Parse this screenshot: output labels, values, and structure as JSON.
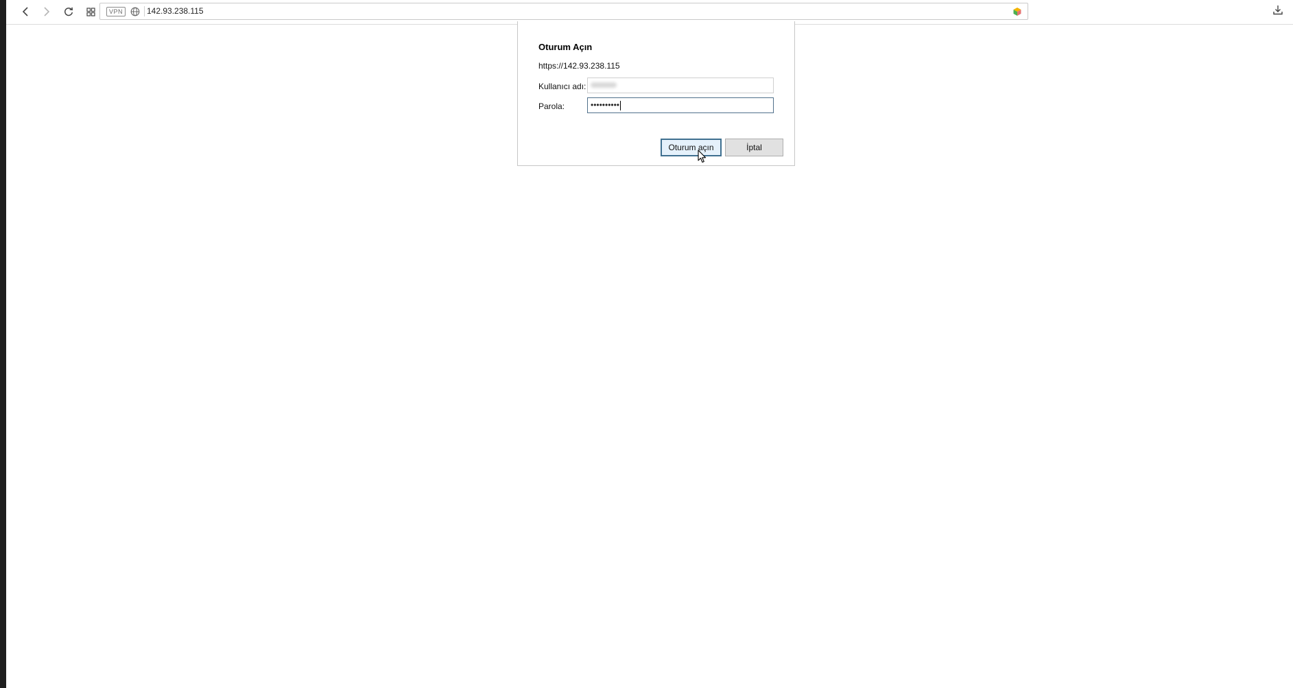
{
  "browser": {
    "address_value": "142.93.238.115",
    "vpn_badge": "VPN",
    "icons": {
      "back": "back-arrow-icon",
      "forward": "forward-arrow-icon",
      "reload": "reload-icon",
      "tabs": "tab-grid-icon",
      "globe": "globe-icon",
      "extension": "extension-icon",
      "download": "download-icon"
    }
  },
  "dialog": {
    "title": "Oturum Açın",
    "url": "https://142.93.238.115",
    "username_label": "Kullanıcı adı:",
    "password_label": "Parola:",
    "password_mask": "••••••••••",
    "login_button": "Oturum açın",
    "cancel_button": "İptal",
    "accent_color": "#3e6f8f"
  }
}
